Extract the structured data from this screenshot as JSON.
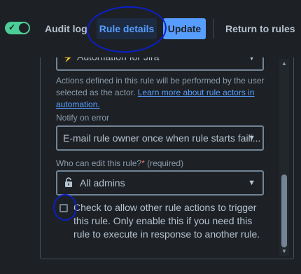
{
  "toolbar": {
    "audit_log": "Audit log",
    "rule_details": "Rule details",
    "update": "Update",
    "return": "Return to rules",
    "toggle_icon": "check-icon"
  },
  "form": {
    "actor_value": "Automation for Jira",
    "actor_help": "Actions defined in this rule will be performed by the user selected as the actor.",
    "actor_help_link": "Learn more about rule actors in automation.",
    "notify_label": "Notify on error",
    "notify_value": "E-mail rule owner once when rule starts faili...",
    "edit_label": "Who can edit this rule?",
    "edit_required_mark": "*",
    "edit_required_text": "(required)",
    "edit_value": "All admins",
    "checkbox_text": "Check to allow other rule actions to trigger this rule. Only enable this if you need this rule to execute in response to another rule.",
    "checkbox_checked": false
  },
  "colors": {
    "accent": "#579dff",
    "toggle_on": "#4bce97",
    "annotation": "#0a1fc7"
  }
}
